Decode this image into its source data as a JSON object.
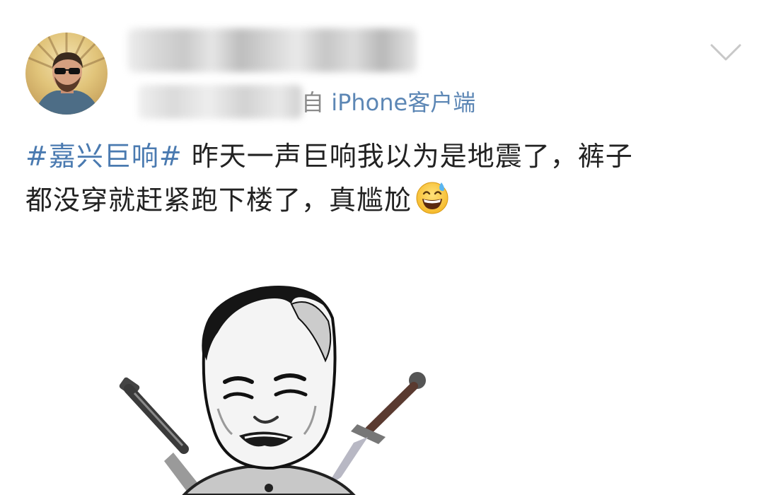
{
  "post": {
    "source_prefix": "自",
    "source_client": "iPhone客户端",
    "hashtag": "#嘉兴巨响#",
    "text_line1": "昨天一声巨响我以为是地震了，裤子",
    "text_line2": "都没穿就赶紧跑下楼了，真尴尬",
    "emoji": "grinning-sweat-emoji"
  },
  "icons": {
    "menu": "chevron-down-icon"
  },
  "colors": {
    "link": "#5d87b5",
    "text": "#222222",
    "chevron": "#c8c8c8"
  }
}
